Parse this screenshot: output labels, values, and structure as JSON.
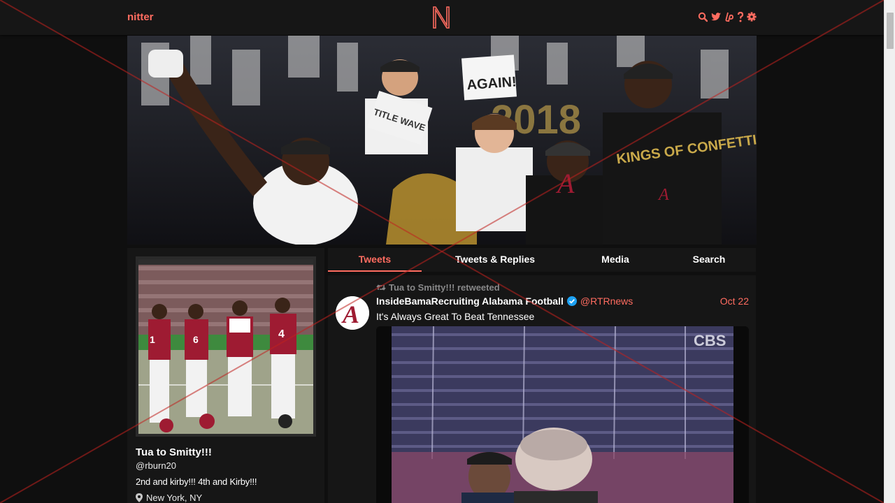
{
  "nav": {
    "brand": "nitter",
    "logo_letter": "N",
    "icons": [
      "search-icon",
      "twitter-bird-icon",
      "liberapay-icon",
      "help-icon",
      "settings-icon"
    ]
  },
  "banner": {
    "signs": [
      "AGAIN!",
      "TITLE WAVE",
      "KINGS OF CONFETTI",
      "2018"
    ]
  },
  "profile": {
    "name": "Tua to Smitty!!!",
    "handle": "@rburn20",
    "bio": "2nd and kirby!!! 4th and Kirby!!!",
    "location": "New York, NY"
  },
  "tabs": [
    {
      "label": "Tweets",
      "active": true
    },
    {
      "label": "Tweets & Replies",
      "active": false
    },
    {
      "label": "Media",
      "active": false
    },
    {
      "label": "Search",
      "active": false
    }
  ],
  "tweet": {
    "retweet_header": "Tua to Smitty!!! retweeted",
    "fullname": "InsideBamaRecruiting Alabama Football",
    "verified": true,
    "username": "@RTRnews",
    "date": "Oct 22",
    "content": "It's Always Great To Beat Tennessee",
    "media_watermark": "CBS"
  },
  "colors": {
    "accent": "#ff6c60",
    "background": "#0f0f0f",
    "panel": "#161616",
    "crimson": "#9e1b32",
    "verified": "#1da1f2"
  }
}
